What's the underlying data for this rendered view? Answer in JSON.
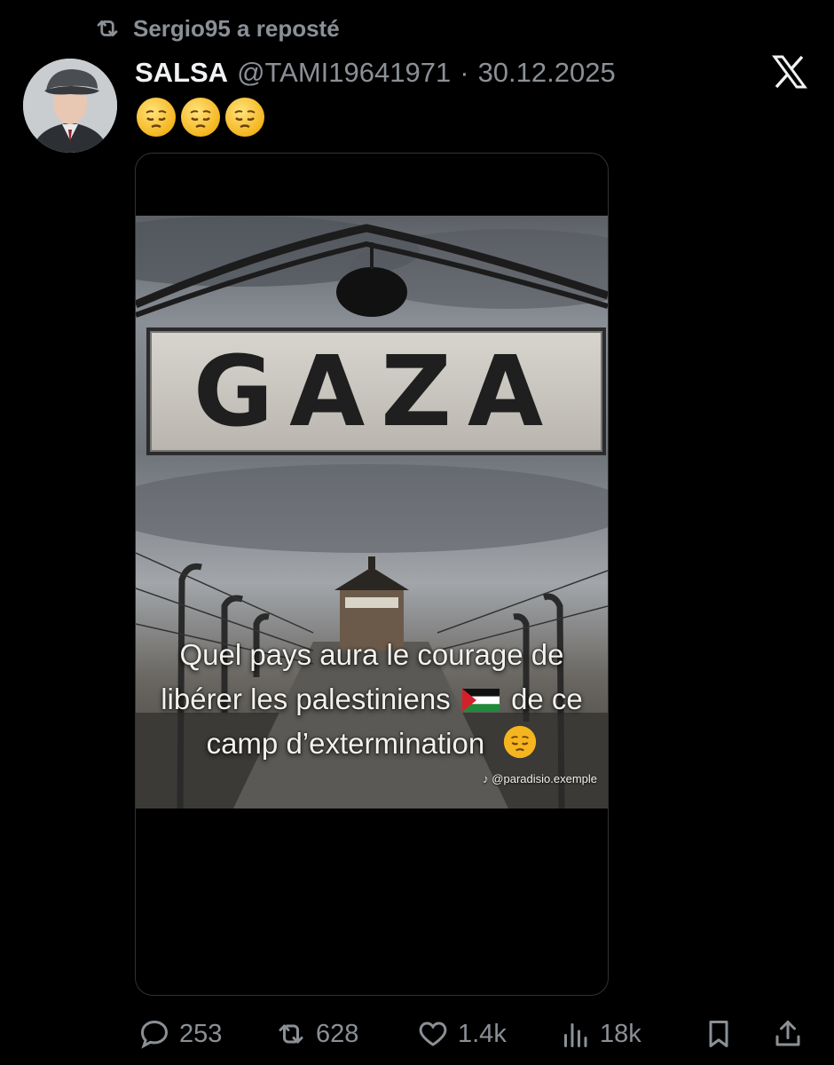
{
  "repost": {
    "text": "Sergio95 a reposté",
    "icon": "repost-icon"
  },
  "tweet": {
    "name": "SALSA",
    "handle": "@TAMI19641971",
    "separator": "·",
    "date": "30.12.2025",
    "emoji_text": "😔😔😔"
  },
  "media": {
    "sign_text": "GAZA",
    "caption_line1": "Quel pays aura le courage de",
    "caption_line2_a": "libérer les palestiniens",
    "caption_line2_b": "de ce",
    "caption_line3": "camp d’extermination",
    "watermark": "@paradisio.exemple"
  },
  "actions": {
    "replies": "253",
    "reposts": "628",
    "likes": "1.4k",
    "views": "18k"
  },
  "colors": {
    "background": "#000000",
    "text_primary": "#e7e9ea",
    "text_secondary": "#8b9096",
    "border": "#2f3336"
  }
}
